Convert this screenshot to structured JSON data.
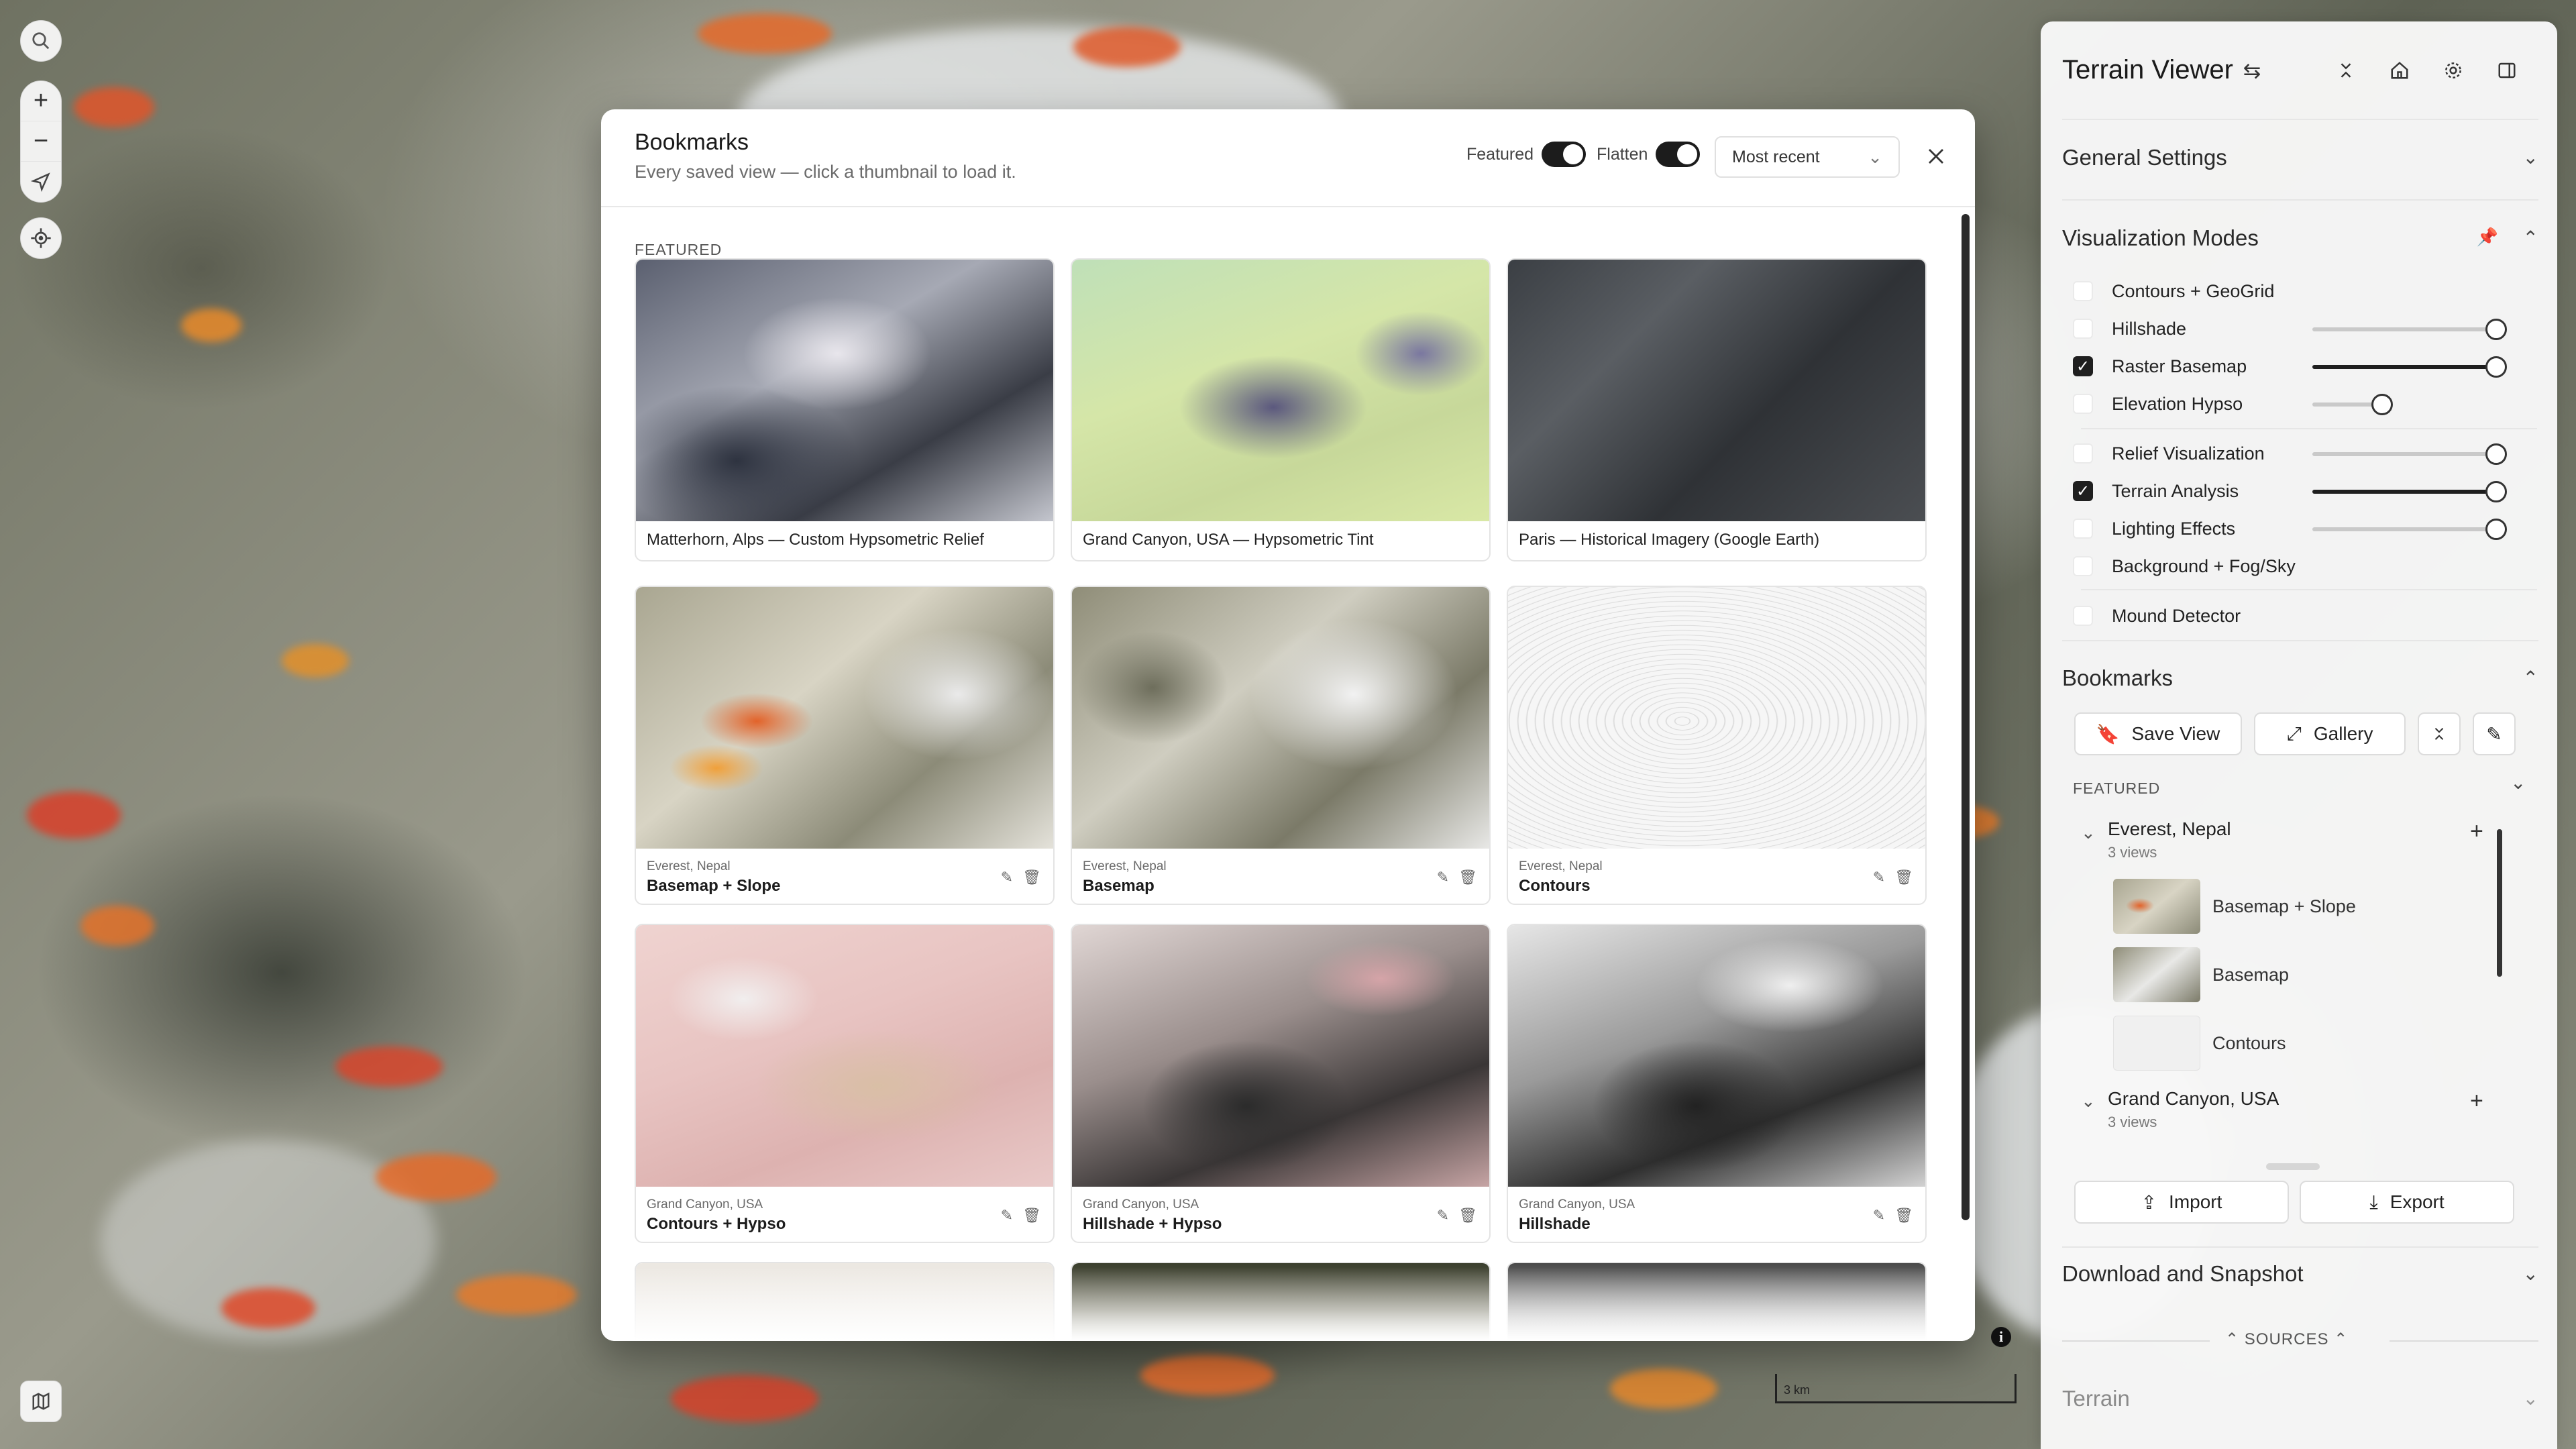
{
  "map": {
    "search_icon": "search-icon",
    "zoom_in": "+",
    "zoom_out": "−",
    "scale_label": "3 km"
  },
  "modal": {
    "title": "Bookmarks",
    "subtitle": "Every saved view — click a thumbnail to load it.",
    "featured_toggle_label": "Featured",
    "flatten_toggle_label": "Flatten",
    "sort_value": "Most recent",
    "section_label": "FEATURED",
    "featured_cards": [
      {
        "caption": "Matterhorn, Alps — Custom Hypsometric Relief"
      },
      {
        "caption": "Grand Canyon, USA — Hypsometric Tint"
      },
      {
        "caption": "Paris — Historical Imagery (Google Earth)"
      }
    ],
    "cards": [
      {
        "location": "Everest, Nepal",
        "name": "Basemap + Slope"
      },
      {
        "location": "Everest, Nepal",
        "name": "Basemap"
      },
      {
        "location": "Everest, Nepal",
        "name": "Contours"
      },
      {
        "location": "Grand Canyon, USA",
        "name": "Contours + Hypso"
      },
      {
        "location": "Grand Canyon, USA",
        "name": "Hillshade + Hypso"
      },
      {
        "location": "Grand Canyon, USA",
        "name": "Hillshade"
      }
    ]
  },
  "panel": {
    "title": "Terrain Viewer",
    "general_settings": "General Settings",
    "visualization_modes": "Visualization Modes",
    "modes": [
      {
        "label": "Contours + GeoGrid",
        "checked": false
      },
      {
        "label": "Hillshade",
        "checked": false,
        "value": 1.0
      },
      {
        "label": "Raster Basemap",
        "checked": true,
        "value": 1.0
      },
      {
        "label": "Elevation Hypso",
        "checked": false,
        "value": 0.35
      },
      {
        "label": "Relief Visualization",
        "checked": false,
        "value": 1.0
      },
      {
        "label": "Terrain Analysis",
        "checked": true,
        "value": 1.0
      },
      {
        "label": "Lighting Effects",
        "checked": false,
        "value": 1.0
      },
      {
        "label": "Background + Fog/Sky",
        "checked": false
      },
      {
        "label": "Mound Detector",
        "checked": false
      }
    ],
    "bookmarks": {
      "title": "Bookmarks",
      "save_view": "Save View",
      "gallery": "Gallery",
      "featured_label": "FEATURED",
      "groups": [
        {
          "name": "Everest, Nepal",
          "count": "3 views",
          "items": [
            "Basemap + Slope",
            "Basemap",
            "Contours"
          ]
        },
        {
          "name": "Grand Canyon, USA",
          "count": "3 views"
        }
      ],
      "import": "Import",
      "export": "Export"
    },
    "download_snapshot": "Download and Snapshot",
    "sources_label": "SOURCES",
    "terrain_label": "Terrain"
  }
}
